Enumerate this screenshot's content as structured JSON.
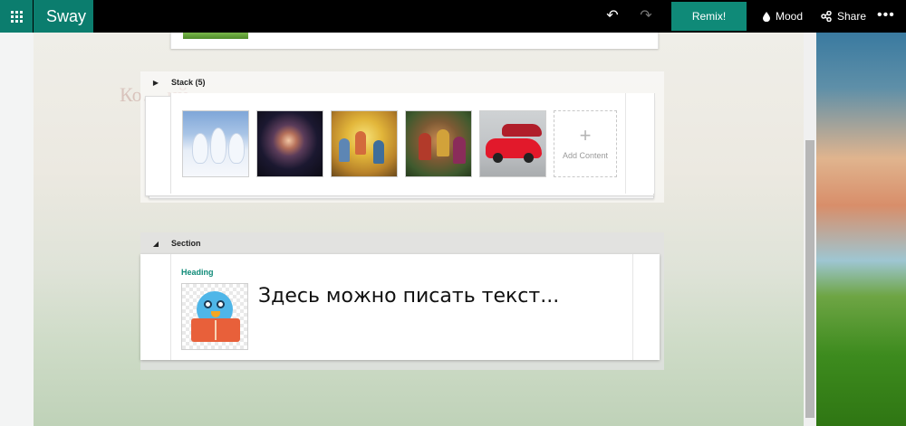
{
  "app": {
    "name": "Sway"
  },
  "toolbar": {
    "undo_icon": "undo-icon",
    "redo_icon": "redo-icon",
    "remix_label": "Remix!",
    "mood_label": "Mood",
    "share_label": "Share",
    "more_label": "•••"
  },
  "background": {
    "hint_text": "Ко…          ий",
    "accent": "#0b7d6e"
  },
  "stack": {
    "title": "Stack (5)",
    "items": [
      {
        "icon": "winter-trees-image"
      },
      {
        "icon": "galaxy-image"
      },
      {
        "icon": "painting-image"
      },
      {
        "icon": "portrait-painting-image"
      },
      {
        "icon": "red-car-image"
      }
    ],
    "add_content_label": "Add Content"
  },
  "section": {
    "title": "Section",
    "heading_label": "Heading",
    "body_text": "Здесь можно писать текст...",
    "image_icon": "bird-reading-image"
  }
}
